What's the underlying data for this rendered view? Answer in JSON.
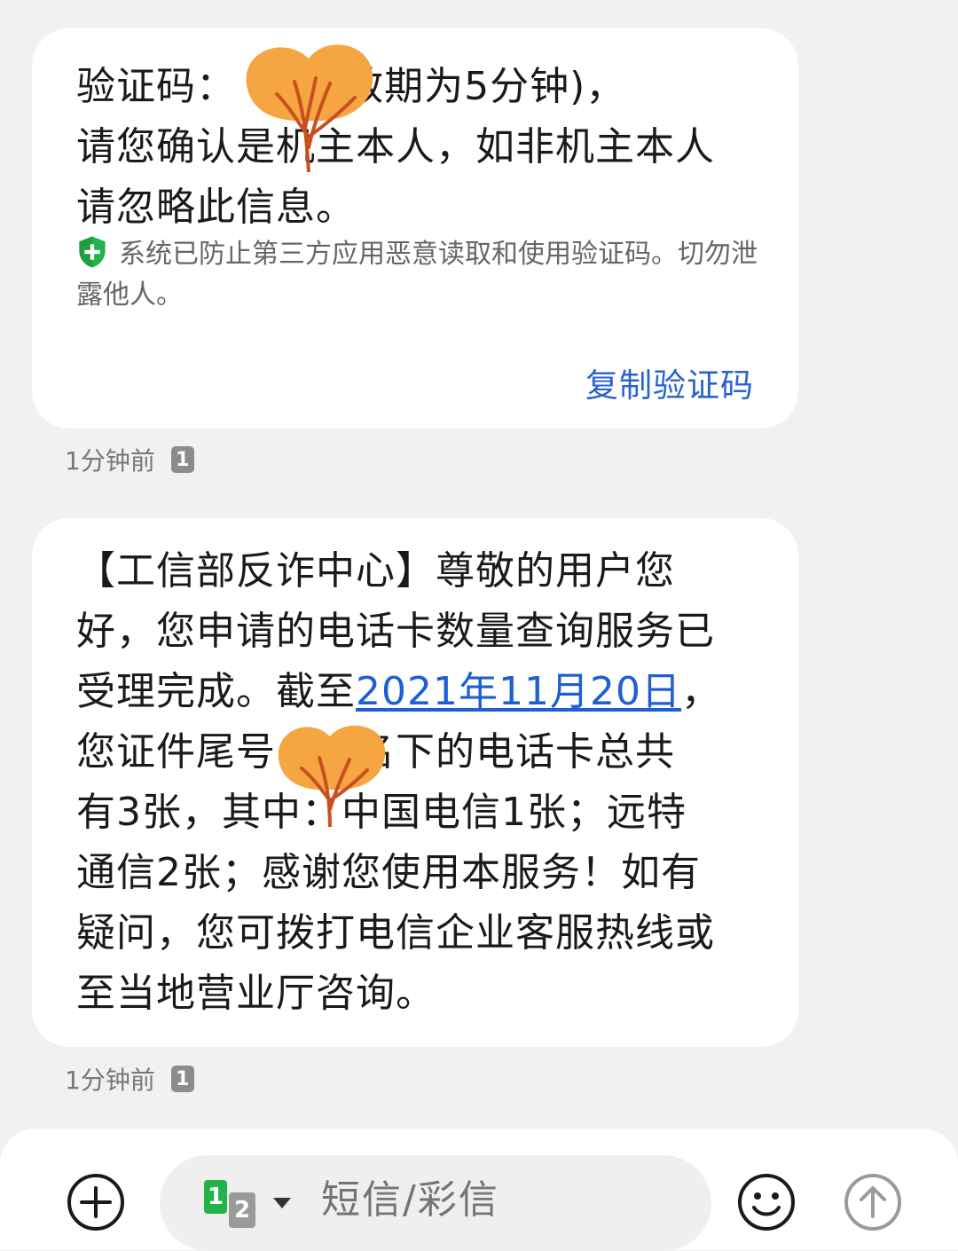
{
  "messages": [
    {
      "body": "验证码：  4(有效期为5分钟)，\n请您确认是机主本人，如非机主本人\n请忽略此信息。",
      "security_notice": "系统已防止第三方应用恶意读取和使用验证码。切勿泄露他人。",
      "action_label": "复制验证码",
      "time": "1分钟前",
      "sim_badge": "1"
    },
    {
      "body_pre": "【工信部反诈中心】尊敬的用户您\n好，您申请的电话卡数量查询服务已\n受理完成。截至",
      "date_link": "2021年11月20日",
      "body_post": "，\n您证件尾号　　名下的电话卡总共\n有3张，其中：中国电信1张；远特\n通信2张；感谢您使用本服务！如有\n疑问，您可拨打电信企业客服热线或\n至当地营业厅咨询。",
      "time": "1分钟前",
      "sim_badge": "1"
    }
  ],
  "composer": {
    "placeholder": "短信/彩信",
    "sim_primary": "1",
    "sim_secondary": "2",
    "add_icon": "plus-circle-icon",
    "emoji_icon": "smiley-icon",
    "send_icon": "send-arrow-icon"
  },
  "colors": {
    "link": "#1f5fd2",
    "shield": "#22b34a",
    "redaction": "#f5a642"
  }
}
